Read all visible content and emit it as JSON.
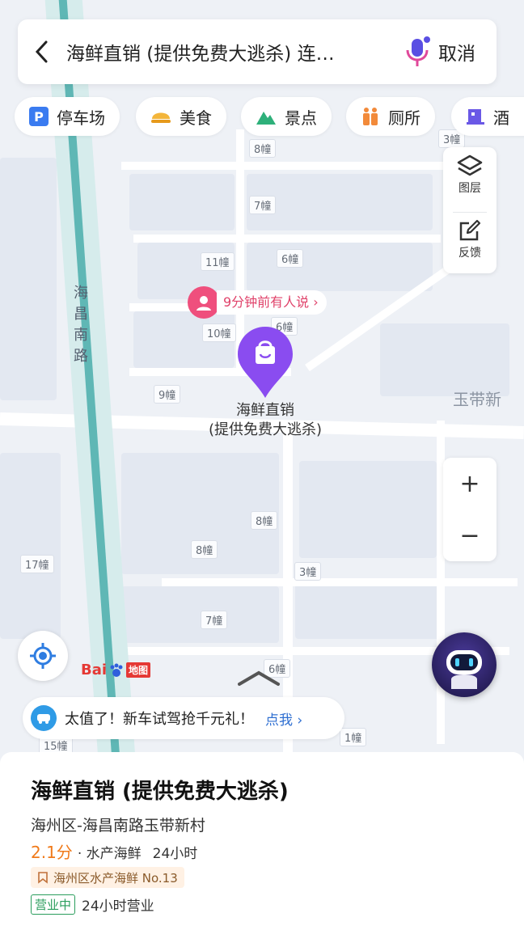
{
  "search": {
    "query": "海鲜直销 (提供免费大逃杀) 连…",
    "cancel_label": "取消"
  },
  "categories": [
    {
      "label": "停车场",
      "icon": "parking-icon",
      "color": "#3a7bf0"
    },
    {
      "label": "美食",
      "icon": "food-icon",
      "color": "#f3b53a"
    },
    {
      "label": "景点",
      "icon": "scenic-icon",
      "color": "#2eb07a"
    },
    {
      "label": "厕所",
      "icon": "toilet-icon",
      "color": "#f28a3a"
    },
    {
      "label": "酒",
      "icon": "hotel-icon",
      "color": "#6a58e6"
    }
  ],
  "side_tools": {
    "layers_label": "图层",
    "feedback_label": "反馈"
  },
  "map": {
    "road_label": "海昌南路",
    "area_label": "玉带新",
    "buildings": [
      "3幢",
      "8幢",
      "7幢",
      "11幢",
      "6幢",
      "10幢",
      "6幢",
      "9幢",
      "8幢",
      "8幢",
      "3幢",
      "17幢",
      "7幢",
      "6幢",
      "1幢",
      "15幢"
    ],
    "comment_bubble": "9分钟前有人说 ›",
    "pin_title_line1": "海鲜直销",
    "pin_title_line2": "(提供免费大逃杀)",
    "logo_text": "Bai",
    "logo_suffix": "地图"
  },
  "zoom": {
    "in_label": "+",
    "out_label": "−"
  },
  "promo": {
    "text": "太值了！新车试驾抢千元礼！",
    "action": "点我 ›"
  },
  "place": {
    "name": "海鲜直销 (提供免费大逃杀)",
    "address": "海州区-海昌南路玉带新村",
    "rating": "2.1分",
    "category": "· 水产海鲜",
    "hours_short": "24小时",
    "rank_tag": "海州区水产海鲜 No.13",
    "status": "营业中",
    "hours": "24小时营业"
  },
  "colors": {
    "accent": "#8a4cf0",
    "rating": "#f07a1a",
    "open_green": "#2a9d5c"
  }
}
